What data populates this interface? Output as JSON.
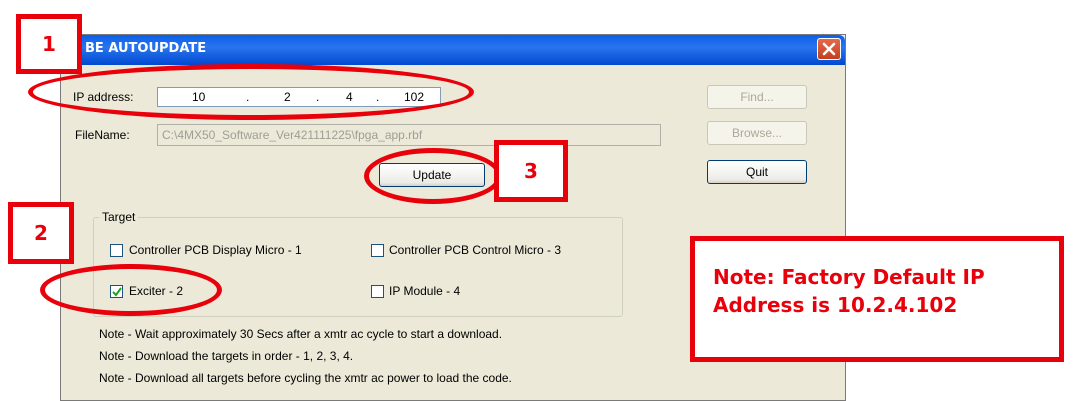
{
  "window": {
    "title": "BE AUTOUPDATE"
  },
  "ip": {
    "label": "IP address:",
    "octets": [
      "10",
      "2",
      "4",
      "102"
    ],
    "separators": [
      ".",
      ".",
      "."
    ]
  },
  "file": {
    "label": "FileName:",
    "value": "C:\\4MX50_Software_Ver421111225\\fpga_app.rbf"
  },
  "buttons": {
    "find": "Find...",
    "browse": "Browse...",
    "quit": "Quit",
    "update": "Update"
  },
  "target": {
    "label": "Target",
    "items": [
      {
        "label": "Controller PCB Display Micro - 1",
        "checked": false
      },
      {
        "label": "Controller PCB Control Micro - 3",
        "checked": false
      },
      {
        "label": "Exciter - 2",
        "checked": true
      },
      {
        "label": "IP Module - 4",
        "checked": false
      }
    ]
  },
  "notes": [
    "Note - Wait approximately 30 Secs after a xmtr ac cycle to start a download.",
    "Note - Download the targets in order - 1, 2, 3, 4.",
    "Note - Download all targets before cycling the xmtr ac power to load the code."
  ],
  "annotations": {
    "badges": [
      "1",
      "2",
      "3"
    ],
    "callout_line1": "Note:  Factory Default IP",
    "callout_line2": "Address is 10.2.4.102",
    "color": "#e8000b"
  },
  "icons": {
    "close": "close-icon",
    "check": "checkmark-icon"
  }
}
